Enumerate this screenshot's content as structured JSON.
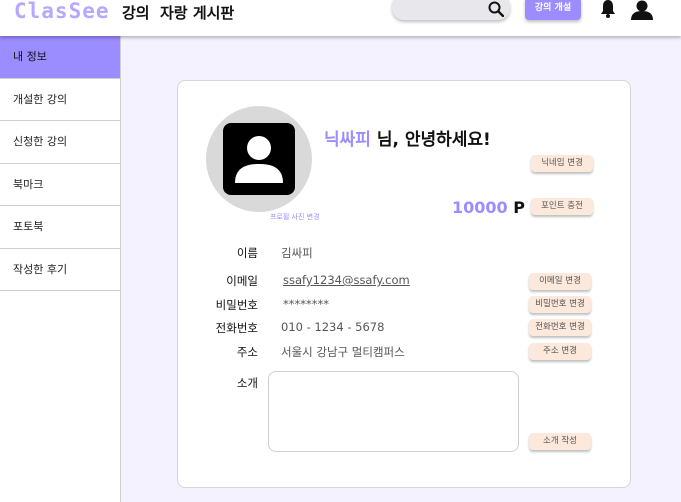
{
  "header": {
    "logo": "ClasSee",
    "nav": [
      "강의",
      "자랑 게시판"
    ],
    "search_placeholder": "",
    "open_course_button": "강의 개설"
  },
  "sidebar": {
    "items": [
      {
        "label": "내 정보",
        "active": true
      },
      {
        "label": "개설한 강의"
      },
      {
        "label": "신청한 강의"
      },
      {
        "label": "북마크"
      },
      {
        "label": "포토북"
      },
      {
        "label": "작성한 후기"
      }
    ]
  },
  "profile": {
    "nickname": "닉싸피",
    "greeting_suffix": " 님, 안녕하세요!",
    "nickname_change_button": "닉네임 변경",
    "photo_change_link": "프로필 사진 변경",
    "points_value": "10000",
    "points_unit": " P",
    "points_charge_button": "포인트 충전"
  },
  "info": {
    "name_label": "이름",
    "name_value": "김싸피",
    "email_label": "이메일",
    "email_value": "ssafy1234@ssafy.com",
    "email_button": "이메일 변경",
    "password_label": "비밀번호",
    "password_value": "********",
    "password_button": "비밀번호 변경",
    "phone_label": "전화번호",
    "phone_value": "010 - 1234 - 5678",
    "phone_button": "전화번호 변경",
    "address_label": "주소",
    "address_value": "서울시 강남구 멀티캠퍼스",
    "address_button": "주소 변경",
    "intro_label": "소개",
    "intro_value": "",
    "intro_button": "소개 작성"
  },
  "colors": {
    "accent": "#9b8cff",
    "logo": "#b4a8ff",
    "button_peach": "#fde8dc",
    "background": "#f4f2ff"
  },
  "icons": [
    "search-icon",
    "bell-icon",
    "user-icon",
    "profile-placeholder-icon"
  ]
}
